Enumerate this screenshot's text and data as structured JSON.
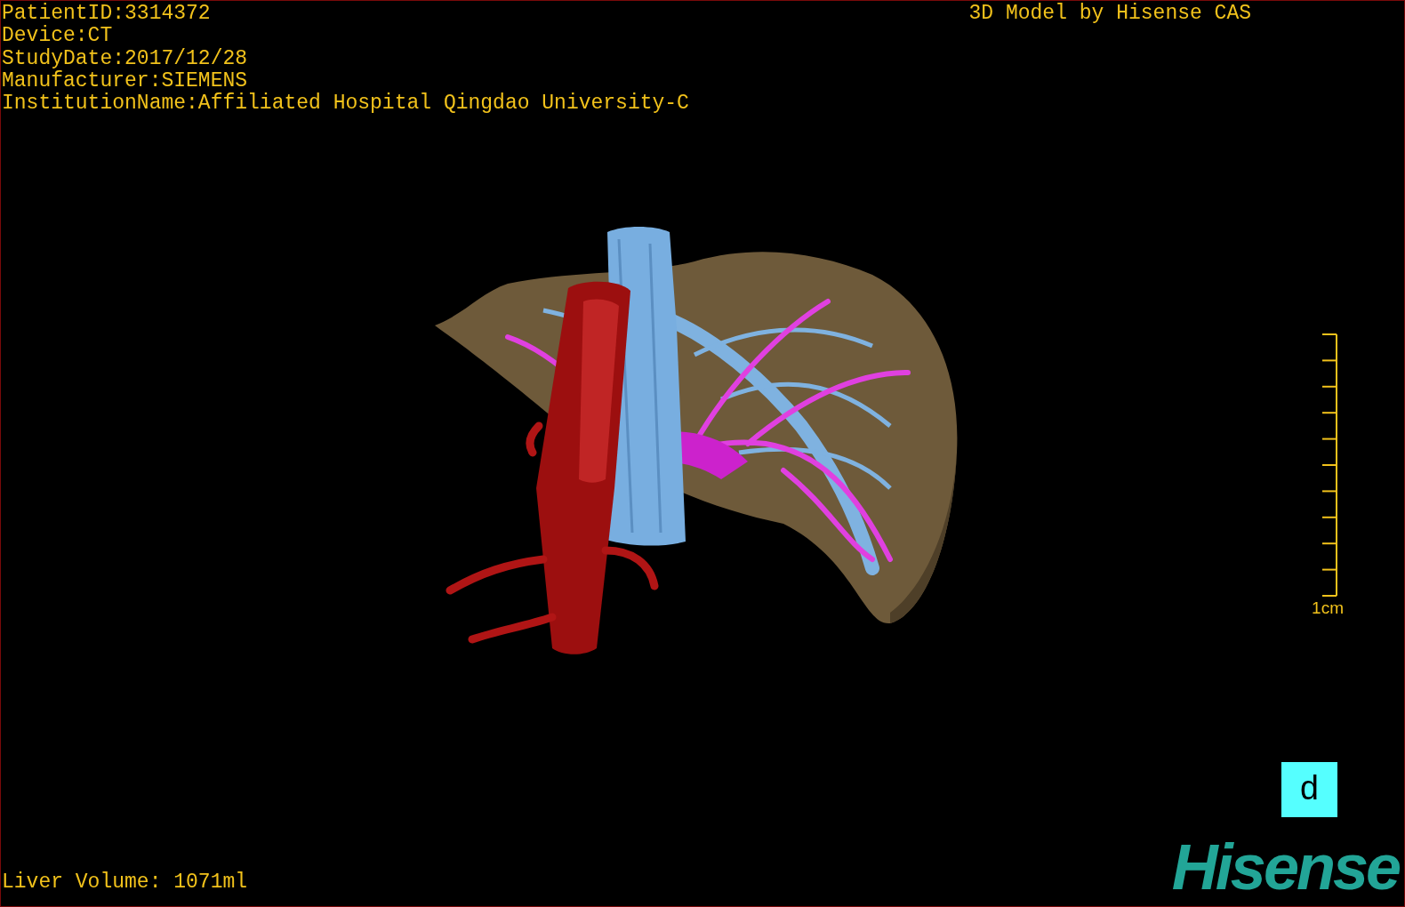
{
  "header": {
    "info_lines": [
      "PatientID:3314372",
      "Device:CT",
      "StudyDate:2017/12/28",
      "Manufacturer:SIEMENS",
      "InstitutionName:Affiliated Hospital Qingdao University-C"
    ],
    "title": "3D Model by Hisense CAS"
  },
  "scale_bar": {
    "label": "1cm"
  },
  "volume": "Liver Volume: 1071ml",
  "view_button": {
    "label": "d"
  },
  "logo": {
    "text": "Hisense"
  }
}
